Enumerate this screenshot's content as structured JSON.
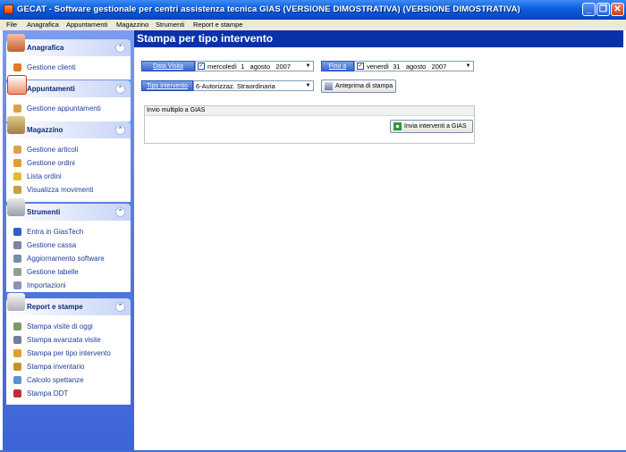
{
  "window": {
    "title": "GECAT - Software gestionale per centri assistenza tecnica GIAS (VERSIONE DIMOSTRATIVA)  (VERSIONE DIMOSTRATIVA)",
    "minimize": "_",
    "maximize": "❐",
    "close": "✕"
  },
  "menu": [
    "File",
    "Anagrafica",
    "Appuntamenti",
    "Magazzino",
    "Strumenti",
    "Report e stampe"
  ],
  "sidebar": {
    "collapse_glyph": "⌃",
    "panels": [
      {
        "title": "Anagrafica",
        "icon": "address-book-icon",
        "items": [
          {
            "label": "Gestione clienti",
            "icon": "clients-icon",
            "color": "#e07a20"
          }
        ]
      },
      {
        "title": "Appuntamenti",
        "icon": "calendar-icon",
        "items": [
          {
            "label": "Gestione appuntamenti",
            "icon": "appointments-icon",
            "color": "#d9a24a"
          }
        ]
      },
      {
        "title": "Magazzino",
        "icon": "warehouse-icon",
        "items": [
          {
            "label": "Gestione articoli",
            "icon": "articles-icon",
            "color": "#d9a24a"
          },
          {
            "label": "Gestione ordini",
            "icon": "orders-icon",
            "color": "#e0a030"
          },
          {
            "label": "Lista ordini",
            "icon": "order-list-icon",
            "color": "#e8b830"
          },
          {
            "label": "Visualizza movimenti",
            "icon": "movements-icon",
            "color": "#c8a040"
          }
        ]
      },
      {
        "title": "Strumenti",
        "icon": "tools-icon",
        "items": [
          {
            "label": "Entra in GiasTech",
            "icon": "giastech-icon",
            "color": "#3060c0"
          },
          {
            "label": "Gestione cassa",
            "icon": "cash-register-icon",
            "color": "#8080a0"
          },
          {
            "label": "Aggiornamento software",
            "icon": "update-icon",
            "color": "#7090b0"
          },
          {
            "label": "Gestione tabelle",
            "icon": "tables-icon",
            "color": "#90a090"
          },
          {
            "label": "Importazioni",
            "icon": "import-icon",
            "color": "#9090b8"
          }
        ]
      },
      {
        "title": "Report e stampe",
        "icon": "printer-icon",
        "items": [
          {
            "label": "Stampa visite di oggi",
            "icon": "visits-today-icon",
            "color": "#7a9a6a"
          },
          {
            "label": "Stampa avanzata visite",
            "icon": "advanced-visits-icon",
            "color": "#7080a0"
          },
          {
            "label": "Stampa per tipo intervento",
            "icon": "intervention-type-icon",
            "color": "#e0a030"
          },
          {
            "label": "Stampa inventario",
            "icon": "inventory-icon",
            "color": "#c89030"
          },
          {
            "label": "Calcolo spettanze",
            "icon": "calculator-icon",
            "color": "#6090d0"
          },
          {
            "label": "Stampa DDT",
            "icon": "ddt-icon",
            "color": "#c03030"
          }
        ]
      }
    ]
  },
  "main": {
    "title": "Stampa per tipo intervento",
    "from": {
      "label": "Data Visita",
      "weekday": "mercoledì",
      "day": "1",
      "month": "agosto",
      "year": "2007",
      "checked": "✓"
    },
    "to": {
      "label": "Fino a",
      "weekday": "venerdì",
      "day": "31",
      "month": "agosto",
      "year": "2007",
      "checked": "✓"
    },
    "type": {
      "label": "Tipo intervento",
      "value": "6-Autorizzaz. Straordinaria"
    },
    "preview_button": "Anteprima di stampa",
    "gias_group": {
      "legend": "Invio multiplo a GIAS",
      "send_button": "Invia interventi a GIAS"
    },
    "dropdown_glyph": "▼"
  }
}
